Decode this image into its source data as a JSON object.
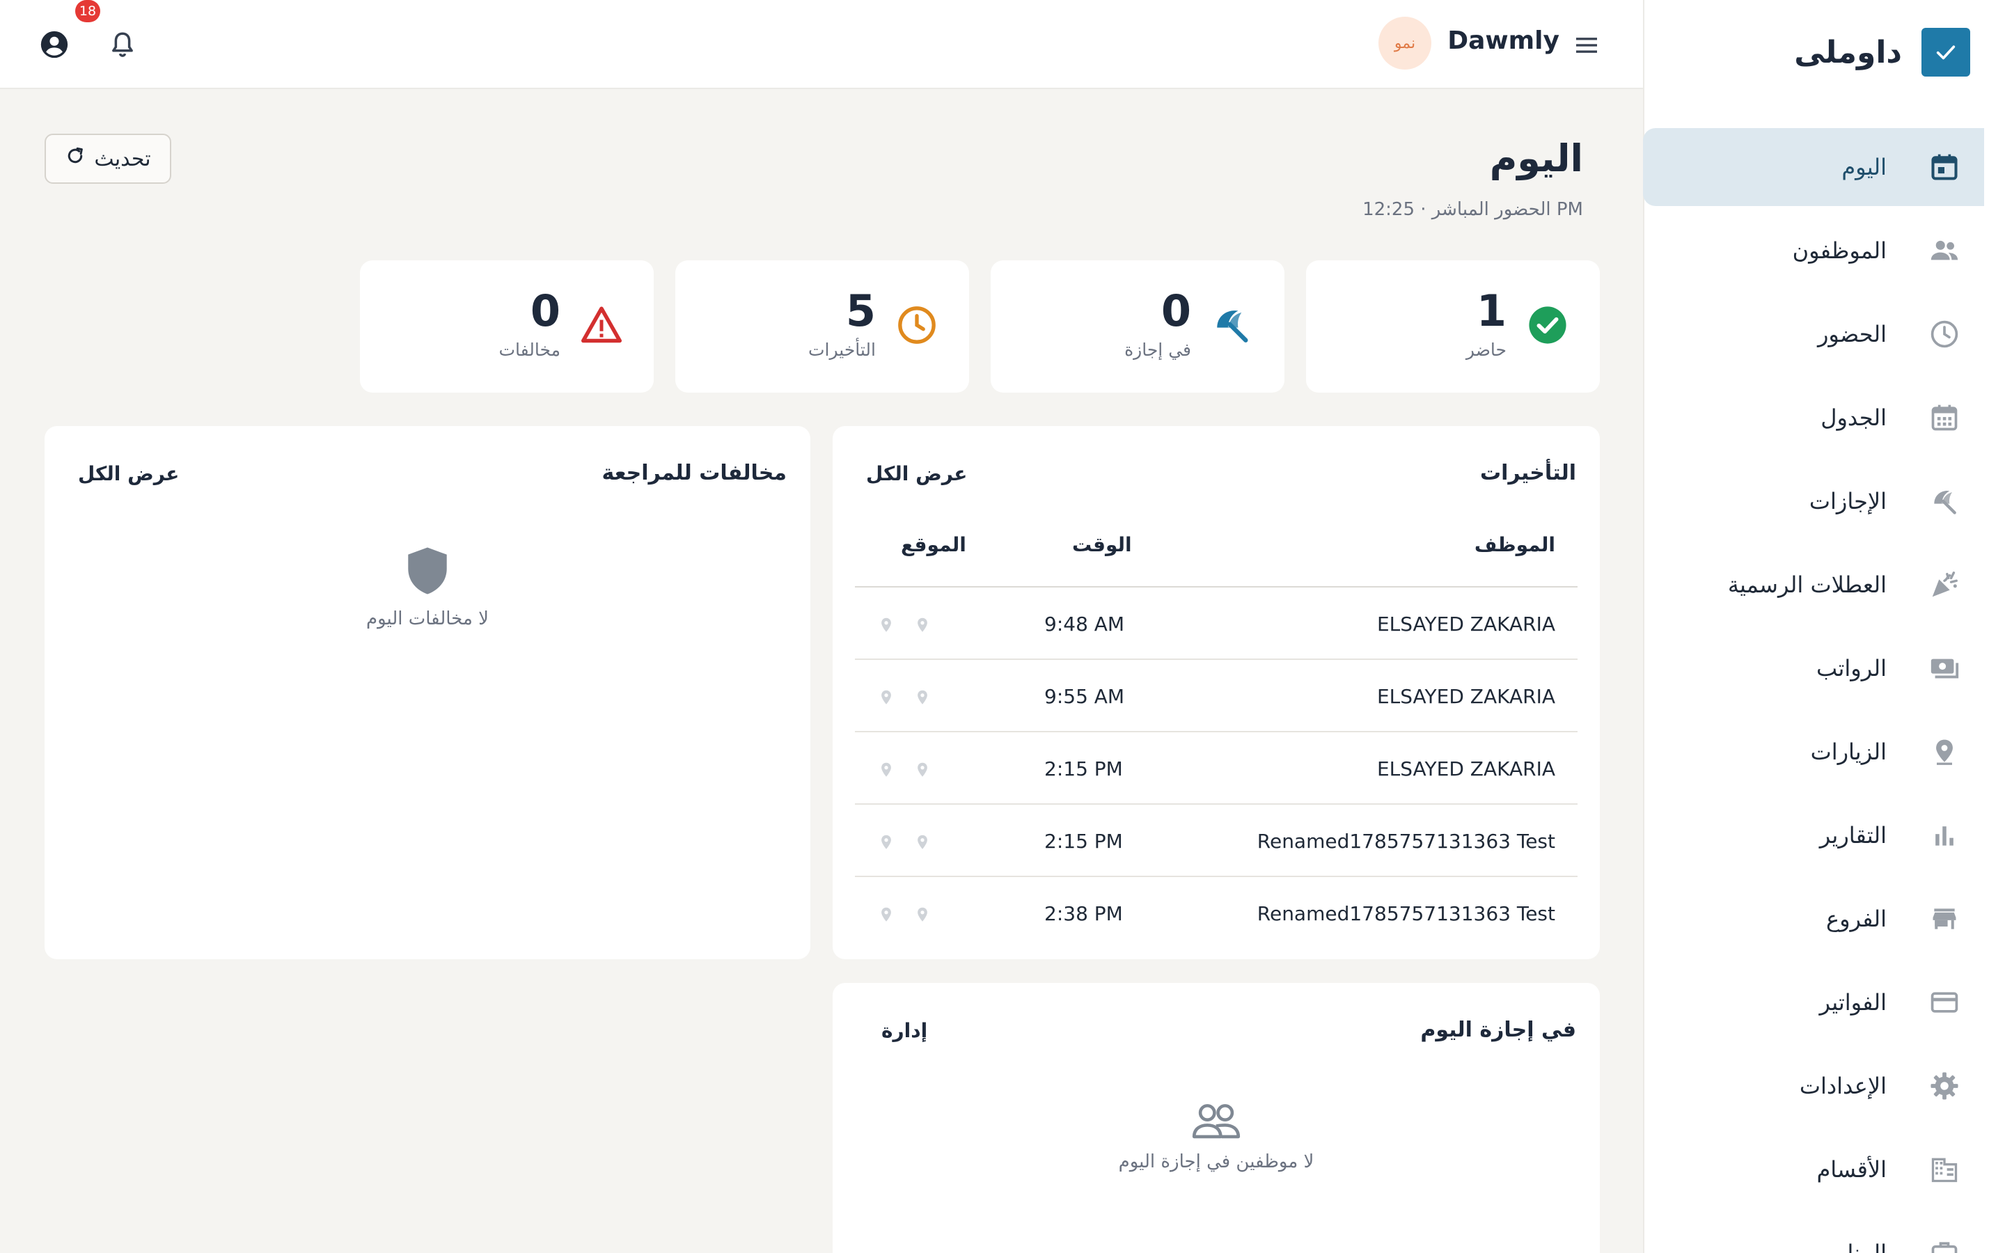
{
  "sidebar": {
    "brand": "داوملى",
    "items": [
      {
        "label": "اليوم",
        "icon": "calendar-today-icon",
        "active": true
      },
      {
        "label": "الموظفون",
        "icon": "people-icon"
      },
      {
        "label": "الحضور",
        "icon": "clock-icon"
      },
      {
        "label": "الجدول",
        "icon": "calendar-grid-icon"
      },
      {
        "label": "الإجازات",
        "icon": "beach-umbrella-icon"
      },
      {
        "label": "العطلات الرسمية",
        "icon": "celebration-icon"
      },
      {
        "label": "الرواتب",
        "icon": "payments-icon"
      },
      {
        "label": "الزيارات",
        "icon": "location-pin-icon"
      },
      {
        "label": "التقارير",
        "icon": "bar-chart-icon"
      },
      {
        "label": "الفروع",
        "icon": "store-icon"
      },
      {
        "label": "الفواتير",
        "icon": "credit-card-icon"
      },
      {
        "label": "الإعدادات",
        "icon": "gear-icon"
      },
      {
        "label": "الأقسام",
        "icon": "building-icon"
      },
      {
        "label": "المنا",
        "icon": "briefcase-icon"
      }
    ]
  },
  "topbar": {
    "app_name": "Dawmly",
    "org_avatar": "نمو",
    "notification_count": "18"
  },
  "header": {
    "title": "اليوم",
    "subtitle": "الحضور المباشر · 12:25 PM",
    "refresh_label": "تحديث"
  },
  "stats": [
    {
      "value": "1",
      "label": "حاضر",
      "icon": "check-circle-icon",
      "color": "#1e9e5a"
    },
    {
      "value": "0",
      "label": "في إجازة",
      "icon": "beach-umbrella-icon",
      "color": "#1f7aa8"
    },
    {
      "value": "5",
      "label": "التأخيرات",
      "icon": "clock-icon",
      "color": "#e08a1e"
    },
    {
      "value": "0",
      "label": "مخالفات",
      "icon": "warning-icon",
      "color": "#d32f2f"
    }
  ],
  "delays": {
    "title": "التأخيرات",
    "view_all": "عرض الكل",
    "columns": {
      "employee": "الموظف",
      "time": "الوقت",
      "location": "الموقع"
    },
    "rows": [
      {
        "employee": "ELSAYED ZAKARIA",
        "time": "9:48 AM"
      },
      {
        "employee": "ELSAYED ZAKARIA",
        "time": "9:55 AM"
      },
      {
        "employee": "ELSAYED ZAKARIA",
        "time": "2:15 PM"
      },
      {
        "employee": "Renamed1785757131363 Test",
        "time": "2:15 PM"
      },
      {
        "employee": "Renamed1785757131363 Test",
        "time": "2:38 PM"
      }
    ]
  },
  "violations": {
    "title": "مخالفات للمراجعة",
    "view_all": "عرض الكل",
    "empty_text": "لا مخالفات اليوم"
  },
  "on_leave": {
    "title": "في إجازة اليوم",
    "manage": "إدارة",
    "empty_text": "لا موظفين في إجازة اليوم"
  },
  "colors": {
    "brand": "#1f7aa8",
    "active_nav_bg": "#dde8ef",
    "badge": "#e53935",
    "background": "#f5f4f1"
  }
}
